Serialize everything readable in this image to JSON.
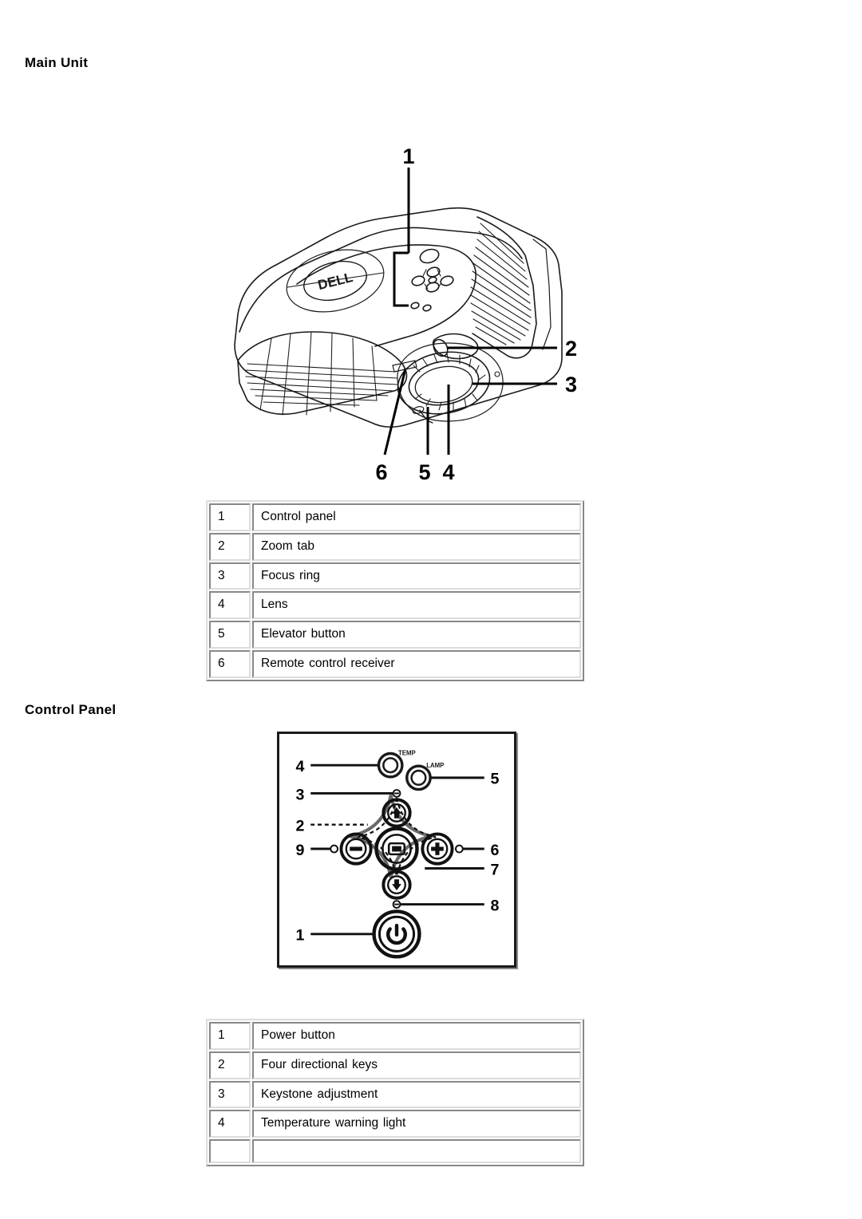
{
  "sections": {
    "main_unit": {
      "heading": "Main Unit",
      "figure_callouts": [
        "1",
        "2",
        "3",
        "4",
        "5",
        "6"
      ],
      "figure_brand": "DELL",
      "table": {
        "rows": [
          {
            "num": "1",
            "label": "Control panel"
          },
          {
            "num": "2",
            "label": "Zoom tab"
          },
          {
            "num": "3",
            "label": "Focus ring"
          },
          {
            "num": "4",
            "label": "Lens"
          },
          {
            "num": "5",
            "label": "Elevator button"
          },
          {
            "num": "6",
            "label": "Remote control receiver"
          }
        ]
      }
    },
    "control_panel": {
      "heading": "Control Panel",
      "figure_callouts": [
        "1",
        "2",
        "3",
        "4",
        "5",
        "6",
        "7",
        "8",
        "9"
      ],
      "figure_indicator_labels": {
        "temp": "TEMP",
        "lamp": "LAMP"
      },
      "table": {
        "rows": [
          {
            "num": "1",
            "label": "Power button"
          },
          {
            "num": "2",
            "label": "Four directional keys"
          },
          {
            "num": "3",
            "label": "Keystone adjustment"
          },
          {
            "num": "4",
            "label": "Temperature warning light"
          },
          {
            "num": "",
            "label": ""
          }
        ]
      }
    }
  },
  "colors": {
    "text": "#000000",
    "page_background": "#ffffff",
    "table_border": "#dcdcdc",
    "figure_line": "#1a1a1a"
  }
}
